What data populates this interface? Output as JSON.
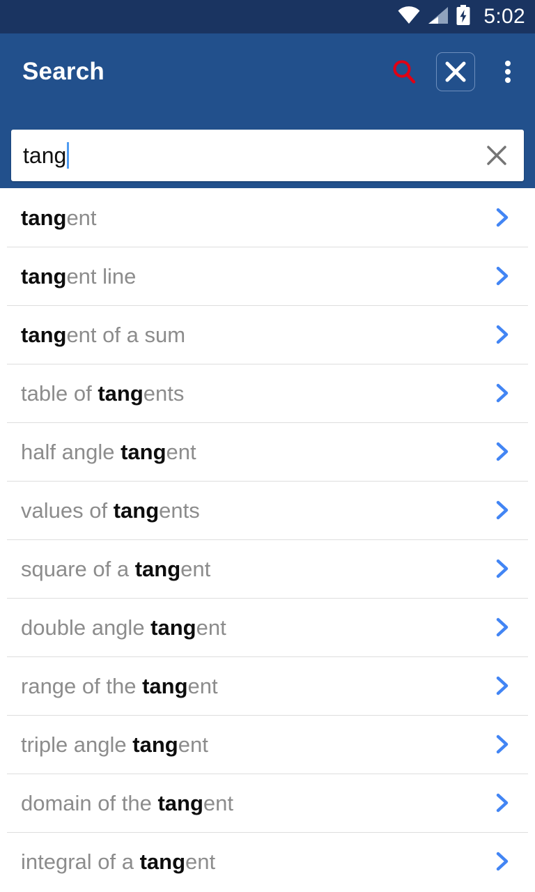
{
  "status_bar": {
    "time": "5:02",
    "icons": [
      "wifi-icon",
      "cellular-signal-icon",
      "battery-charging-icon"
    ],
    "background_color": "#1a3461"
  },
  "toolbar": {
    "title": "Search",
    "background_color": "#22508c",
    "search_icon_color": "#e00014",
    "actions": [
      {
        "name": "search-icon",
        "label": "Search"
      },
      {
        "name": "close-icon",
        "label": "Close"
      },
      {
        "name": "overflow-menu-icon",
        "label": "More options"
      }
    ]
  },
  "search": {
    "value": "tang",
    "placeholder": "Search",
    "clear_label": "Clear",
    "caret_color": "#4f9bf0"
  },
  "suggestions": {
    "query": "tang",
    "match_color": "#0d0d0d",
    "rest_color": "#8c8c8c",
    "chevron_color": "#4285f4",
    "items": [
      {
        "prefix": "",
        "match": "tang",
        "suffix": "ent",
        "text": "tangent"
      },
      {
        "prefix": "",
        "match": "tang",
        "suffix": "ent line",
        "text": "tangent line"
      },
      {
        "prefix": "",
        "match": "tang",
        "suffix": "ent of a sum",
        "text": "tangent of a sum"
      },
      {
        "prefix": "table of ",
        "match": "tang",
        "suffix": "ents",
        "text": "table of tangents"
      },
      {
        "prefix": "half angle ",
        "match": "tang",
        "suffix": "ent",
        "text": "half angle tangent"
      },
      {
        "prefix": "values of ",
        "match": "tang",
        "suffix": "ents",
        "text": "values of tangents"
      },
      {
        "prefix": "square of a ",
        "match": "tang",
        "suffix": "ent",
        "text": "square of a tangent"
      },
      {
        "prefix": "double angle ",
        "match": "tang",
        "suffix": "ent",
        "text": "double angle tangent"
      },
      {
        "prefix": "range of the ",
        "match": "tang",
        "suffix": "ent",
        "text": "range of the tangent"
      },
      {
        "prefix": "triple angle ",
        "match": "tang",
        "suffix": "ent",
        "text": "triple angle tangent"
      },
      {
        "prefix": "domain of the ",
        "match": "tang",
        "suffix": "ent",
        "text": "domain of the tangent"
      },
      {
        "prefix": "integral of a ",
        "match": "tang",
        "suffix": "ent",
        "text": "integral of a tangent"
      }
    ]
  }
}
